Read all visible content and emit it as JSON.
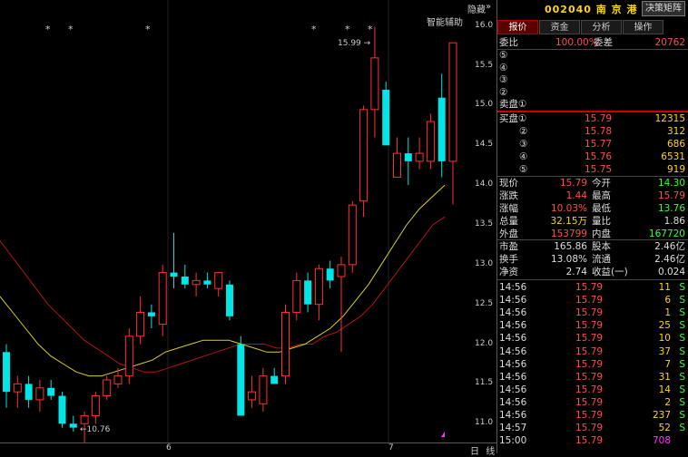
{
  "header": {
    "hide_label": "隐藏",
    "collapse_icon": "double-chevron-right-icon",
    "stock_code": "002040",
    "stock_name": "南 京 港",
    "decision_button": "决策矩阵",
    "assist_label": "智能辅助"
  },
  "tabs": [
    {
      "label": "报价",
      "active": true
    },
    {
      "label": "资金",
      "active": false
    },
    {
      "label": "分析",
      "active": false
    },
    {
      "label": "操作",
      "active": false
    }
  ],
  "ratio": {
    "label": "委比",
    "value": "100.00%",
    "diff_label": "委差",
    "diff_value": "20762"
  },
  "sell": [
    {
      "label": "⑤",
      "price": "",
      "vol": ""
    },
    {
      "label": "④",
      "price": "",
      "vol": ""
    },
    {
      "label": "③",
      "price": "",
      "vol": ""
    },
    {
      "label": "②",
      "price": "",
      "vol": ""
    },
    {
      "label": "卖盘①",
      "price": "",
      "vol": ""
    }
  ],
  "buy": [
    {
      "label": "买盘①",
      "price": "15.79",
      "vol": "12315"
    },
    {
      "label": "②",
      "price": "15.78",
      "vol": "312"
    },
    {
      "label": "③",
      "price": "15.77",
      "vol": "686"
    },
    {
      "label": "④",
      "price": "15.76",
      "vol": "6531"
    },
    {
      "label": "⑤",
      "price": "15.75",
      "vol": "919"
    }
  ],
  "stats": [
    {
      "l1": "现价",
      "v1": "15.79",
      "c1": "red",
      "l2": "今开",
      "v2": "14.30",
      "c2": "lgreen"
    },
    {
      "l1": "涨跌",
      "v1": "1.44",
      "c1": "red",
      "l2": "最高",
      "v2": "15.79",
      "c2": "red"
    },
    {
      "l1": "涨幅",
      "v1": "10.03%",
      "c1": "red",
      "l2": "最低",
      "v2": "13.76",
      "c2": "lgreen"
    },
    {
      "l1": "总量",
      "v1": "32.15万",
      "c1": "yellow",
      "l2": "量比",
      "v2": "1.86",
      "c2": "white"
    },
    {
      "l1": "外盘",
      "v1": "153799",
      "c1": "red",
      "l2": "内盘",
      "v2": "167720",
      "c2": "lgreen"
    }
  ],
  "fundamentals": [
    {
      "l1": "市盈",
      "v1": "165.86",
      "l2": "股本",
      "v2": "2.46亿"
    },
    {
      "l1": "换手",
      "v1": "13.08%",
      "l2": "流通",
      "v2": "2.46亿"
    },
    {
      "l1": "净资",
      "v1": "2.74",
      "l2": "收益(一)",
      "v2": "0.024"
    }
  ],
  "ticks": [
    {
      "time": "14:56",
      "price": "15.79",
      "vol": "11",
      "side": "S"
    },
    {
      "time": "14:56",
      "price": "15.79",
      "vol": "6",
      "side": "S"
    },
    {
      "time": "14:56",
      "price": "15.79",
      "vol": "1",
      "side": "S"
    },
    {
      "time": "14:56",
      "price": "15.79",
      "vol": "25",
      "side": "S"
    },
    {
      "time": "14:56",
      "price": "15.79",
      "vol": "10",
      "side": "S"
    },
    {
      "time": "14:56",
      "price": "15.79",
      "vol": "37",
      "side": "S"
    },
    {
      "time": "14:56",
      "price": "15.79",
      "vol": "7",
      "side": "S"
    },
    {
      "time": "14:56",
      "price": "15.79",
      "vol": "31",
      "side": "S"
    },
    {
      "time": "14:56",
      "price": "15.79",
      "vol": "14",
      "side": "S"
    },
    {
      "time": "14:56",
      "price": "15.79",
      "vol": "2",
      "side": "S"
    },
    {
      "time": "14:56",
      "price": "15.79",
      "vol": "237",
      "side": "S"
    },
    {
      "time": "14:57",
      "price": "15.79",
      "vol": "52",
      "side": "S"
    },
    {
      "time": "15:00",
      "price": "15.79",
      "vol": "708",
      "side": ""
    }
  ],
  "axis_labels": [
    "16.0",
    "15.5",
    "15.0",
    "14.5",
    "14.0",
    "13.5",
    "13.0",
    "12.5",
    "12.0",
    "11.5",
    "11.0"
  ],
  "bottom": {
    "day_label": "日",
    "line_label": "线",
    "month_6": "6",
    "month_7": "7"
  },
  "chart_data": {
    "type": "candlestick",
    "ylim": [
      10.9,
      16.1
    ],
    "high_label": "15.99",
    "low_label": "10.76",
    "star_marker": "*",
    "candles": [
      {
        "o": 11.9,
        "h": 12.0,
        "l": 11.2,
        "c": 11.4,
        "up": false
      },
      {
        "o": 11.4,
        "h": 11.6,
        "l": 11.2,
        "c": 11.5,
        "up": true
      },
      {
        "o": 11.5,
        "h": 11.6,
        "l": 11.2,
        "c": 11.3,
        "up": false
      },
      {
        "o": 11.3,
        "h": 11.55,
        "l": 11.15,
        "c": 11.45,
        "up": true
      },
      {
        "o": 11.45,
        "h": 11.55,
        "l": 11.3,
        "c": 11.35,
        "up": false
      },
      {
        "o": 11.35,
        "h": 11.4,
        "l": 10.95,
        "c": 11.0,
        "up": false
      },
      {
        "o": 11.0,
        "h": 11.1,
        "l": 10.9,
        "c": 10.95,
        "up": false
      },
      {
        "o": 11.0,
        "h": 11.15,
        "l": 10.76,
        "c": 11.1,
        "up": true
      },
      {
        "o": 11.1,
        "h": 11.4,
        "l": 11.0,
        "c": 11.35,
        "up": true
      },
      {
        "o": 11.35,
        "h": 11.6,
        "l": 11.3,
        "c": 11.55,
        "up": true
      },
      {
        "o": 11.5,
        "h": 11.7,
        "l": 11.45,
        "c": 11.6,
        "up": true
      },
      {
        "o": 11.6,
        "h": 12.2,
        "l": 11.5,
        "c": 12.1,
        "up": true
      },
      {
        "o": 12.1,
        "h": 12.6,
        "l": 12.0,
        "c": 12.4,
        "up": true
      },
      {
        "o": 12.4,
        "h": 12.5,
        "l": 12.2,
        "c": 12.35,
        "up": false
      },
      {
        "o": 12.25,
        "h": 13.0,
        "l": 12.1,
        "c": 12.9,
        "up": true
      },
      {
        "o": 12.9,
        "h": 13.4,
        "l": 12.7,
        "c": 12.85,
        "up": false
      },
      {
        "o": 12.85,
        "h": 13.0,
        "l": 12.7,
        "c": 12.75,
        "up": false
      },
      {
        "o": 12.75,
        "h": 12.9,
        "l": 12.6,
        "c": 12.8,
        "up": true
      },
      {
        "o": 12.8,
        "h": 12.9,
        "l": 12.7,
        "c": 12.75,
        "up": false
      },
      {
        "o": 12.7,
        "h": 12.9,
        "l": 12.6,
        "c": 12.9,
        "up": true
      },
      {
        "o": 12.75,
        "h": 12.8,
        "l": 12.3,
        "c": 12.35,
        "up": false
      },
      {
        "o": 12.0,
        "h": 12.1,
        "l": 11.1,
        "c": 11.1,
        "up": false
      },
      {
        "o": 11.3,
        "h": 11.6,
        "l": 11.2,
        "c": 11.4,
        "up": true
      },
      {
        "o": 11.25,
        "h": 11.7,
        "l": 11.15,
        "c": 11.6,
        "up": true
      },
      {
        "o": 11.6,
        "h": 11.7,
        "l": 11.5,
        "c": 11.5,
        "up": false
      },
      {
        "o": 11.6,
        "h": 12.5,
        "l": 11.5,
        "c": 12.4,
        "up": true
      },
      {
        "o": 12.4,
        "h": 12.9,
        "l": 12.3,
        "c": 12.8,
        "up": true
      },
      {
        "o": 12.8,
        "h": 12.9,
        "l": 12.4,
        "c": 12.5,
        "up": false
      },
      {
        "o": 12.5,
        "h": 13.0,
        "l": 12.3,
        "c": 12.95,
        "up": true
      },
      {
        "o": 12.95,
        "h": 13.05,
        "l": 12.7,
        "c": 12.8,
        "up": false
      },
      {
        "o": 12.85,
        "h": 13.1,
        "l": 11.9,
        "c": 13.0,
        "up": true
      },
      {
        "o": 13.0,
        "h": 13.8,
        "l": 12.9,
        "c": 13.75,
        "up": true
      },
      {
        "o": 13.8,
        "h": 15.0,
        "l": 13.6,
        "c": 14.95,
        "up": true
      },
      {
        "o": 14.95,
        "h": 15.99,
        "l": 14.6,
        "c": 15.6,
        "up": true
      },
      {
        "o": 15.2,
        "h": 15.3,
        "l": 14.5,
        "c": 14.5,
        "up": false
      },
      {
        "o": 14.4,
        "h": 14.6,
        "l": 14.1,
        "c": 14.1,
        "up": true
      },
      {
        "o": 14.3,
        "h": 14.6,
        "l": 14.0,
        "c": 14.4,
        "up": false
      },
      {
        "o": 14.3,
        "h": 14.6,
        "l": 14.2,
        "c": 14.4,
        "up": true
      },
      {
        "o": 14.8,
        "h": 14.9,
        "l": 14.2,
        "c": 14.3,
        "up": true
      },
      {
        "o": 14.3,
        "h": 15.4,
        "l": 14.1,
        "c": 15.1,
        "up": false
      },
      {
        "o": 14.3,
        "h": 15.79,
        "l": 13.76,
        "c": 15.79,
        "up": true
      }
    ],
    "ma_yellow": [
      12.6,
      12.4,
      12.2,
      12.0,
      11.85,
      11.75,
      11.65,
      11.6,
      11.6,
      11.65,
      11.7,
      11.75,
      11.8,
      11.9,
      11.95,
      12.0,
      12.05,
      12.05,
      12.05,
      12.0,
      11.95,
      11.9,
      11.9,
      11.95,
      12.0,
      12.1,
      12.2,
      12.35,
      12.55,
      12.75,
      13.0,
      13.25,
      13.5,
      13.7,
      13.85,
      14.0
    ],
    "ma_red": [
      13.3,
      13.1,
      12.9,
      12.7,
      12.5,
      12.35,
      12.2,
      12.05,
      11.95,
      11.85,
      11.75,
      11.7,
      11.65,
      11.65,
      11.7,
      11.75,
      11.8,
      11.85,
      11.9,
      11.95,
      12.0,
      12.0,
      12.0,
      11.95,
      11.95,
      12.0,
      12.0,
      12.1,
      12.15,
      12.25,
      12.35,
      12.5,
      12.7,
      12.9,
      13.1,
      13.3,
      13.5,
      13.6
    ]
  }
}
